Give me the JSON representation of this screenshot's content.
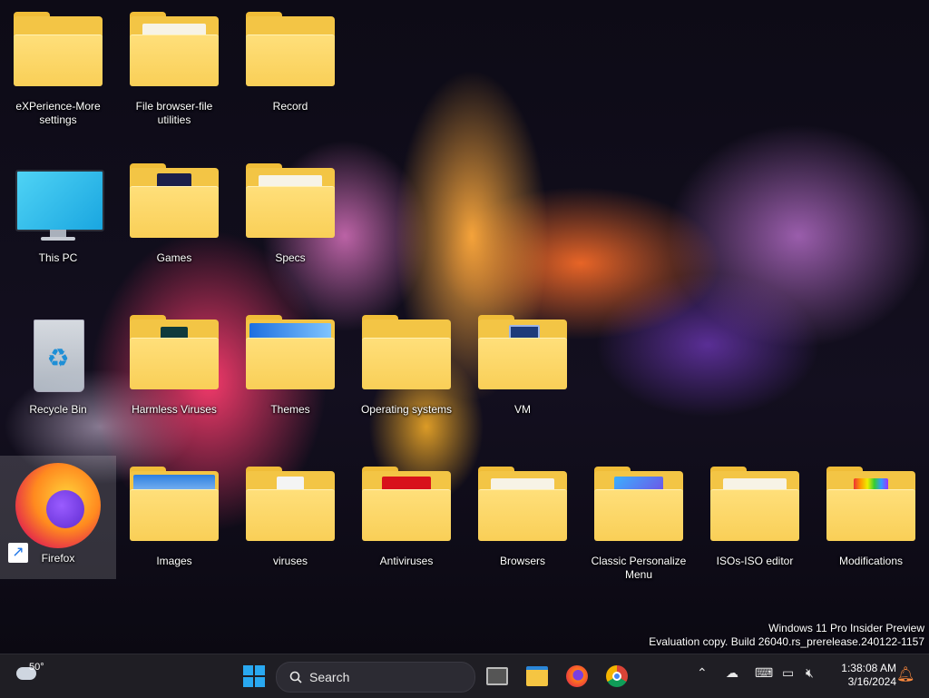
{
  "desktop": {
    "icons": {
      "experience": {
        "label": "eXPerience-More settings",
        "icon": "folder-icon"
      },
      "filebrowser": {
        "label": "File browser-file utilities",
        "icon": "folder-icon"
      },
      "record": {
        "label": "Record",
        "icon": "folder-icon"
      },
      "thispc": {
        "label": "This PC",
        "icon": "monitor-icon"
      },
      "games": {
        "label": "Games",
        "icon": "folder-icon"
      },
      "specs": {
        "label": "Specs",
        "icon": "folder-icon"
      },
      "recyclebin": {
        "label": "Recycle Bin",
        "icon": "recycle-bin-icon"
      },
      "harmless": {
        "label": "Harmless Viruses",
        "icon": "folder-icon"
      },
      "themes": {
        "label": "Themes",
        "icon": "folder-icon"
      },
      "os": {
        "label": "Operating systems",
        "icon": "folder-icon"
      },
      "vm": {
        "label": "VM",
        "icon": "folder-icon"
      },
      "firefox": {
        "label": "Firefox",
        "icon": "firefox-icon"
      },
      "images": {
        "label": "Images",
        "icon": "folder-icon"
      },
      "viruses": {
        "label": "viruses",
        "icon": "folder-icon"
      },
      "antiviruses": {
        "label": "Antiviruses",
        "icon": "folder-icon"
      },
      "browsers": {
        "label": "Browsers",
        "icon": "folder-icon"
      },
      "classic": {
        "label": "Classic Personalize Menu",
        "icon": "folder-icon"
      },
      "isos": {
        "label": "ISOs-ISO editor",
        "icon": "folder-icon"
      },
      "mods": {
        "label": "Modifications",
        "icon": "folder-icon"
      }
    },
    "watermark": {
      "line1": "Windows 11 Pro Insider Preview",
      "line2": "Evaluation copy. Build 26040.rs_prerelease.240122-1157"
    }
  },
  "taskbar": {
    "weather": {
      "temp": "50°",
      "icon": "weather-cloud-sun-icon"
    },
    "search": {
      "placeholder": "Search"
    },
    "clock": {
      "time": "1:38:08 AM",
      "date": "3/16/2024"
    },
    "colors": {
      "accent": "#0078d4",
      "taskbar_bg": "#1f1e24",
      "folder": "#f9cf57"
    }
  }
}
